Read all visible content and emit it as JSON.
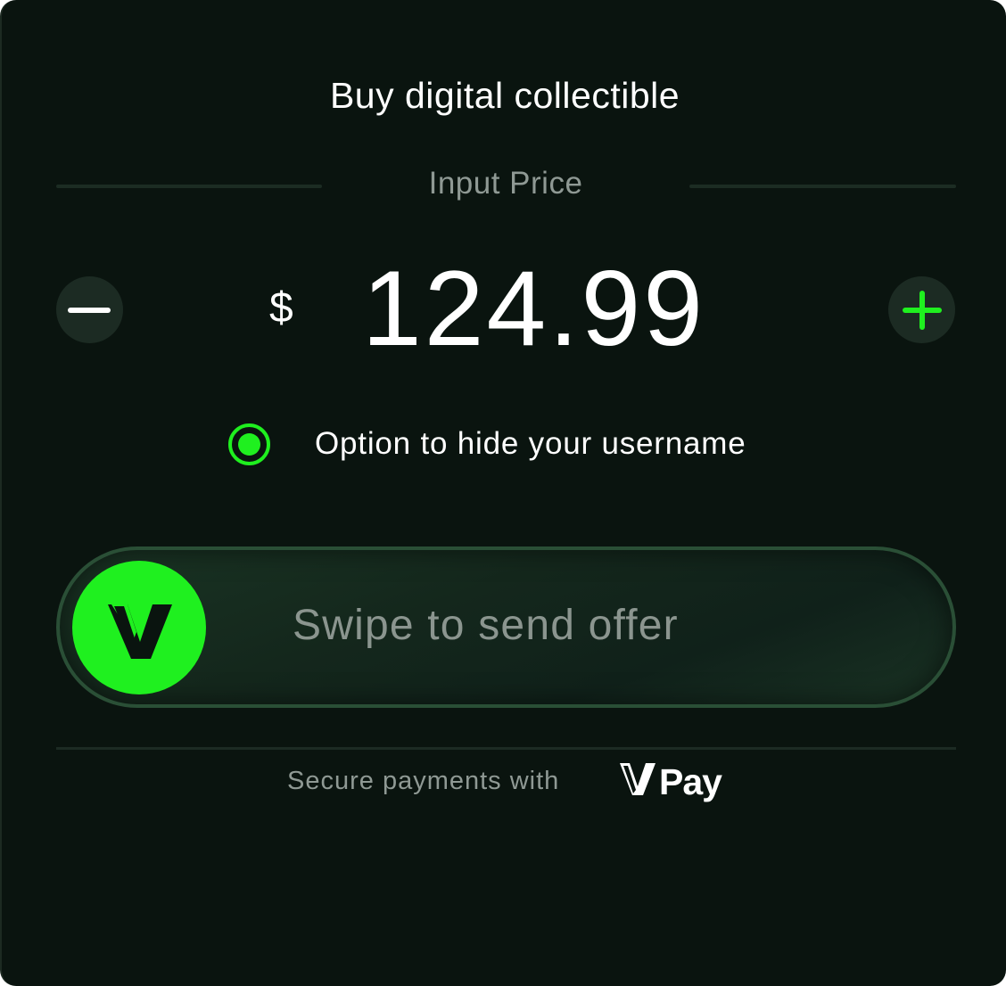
{
  "dialog": {
    "title": "Buy digital collectible"
  },
  "price": {
    "label": "Input Price",
    "currency_symbol": "$",
    "amount": "124.99",
    "decrement_icon": "minus-icon",
    "increment_icon": "plus-icon"
  },
  "hide_username": {
    "label": "Option to hide your username",
    "selected": true
  },
  "swipe": {
    "label": "Swipe to send offer",
    "knob_icon": "v-logo-icon"
  },
  "footer": {
    "secure_text": "Secure payments with",
    "brand_name": "Pay"
  },
  "colors": {
    "background": "#0a140f",
    "accent": "#1ff01f",
    "muted_text": "#8f9994",
    "button_bg": "#1c2b23",
    "track_border": "#2a4f36"
  }
}
